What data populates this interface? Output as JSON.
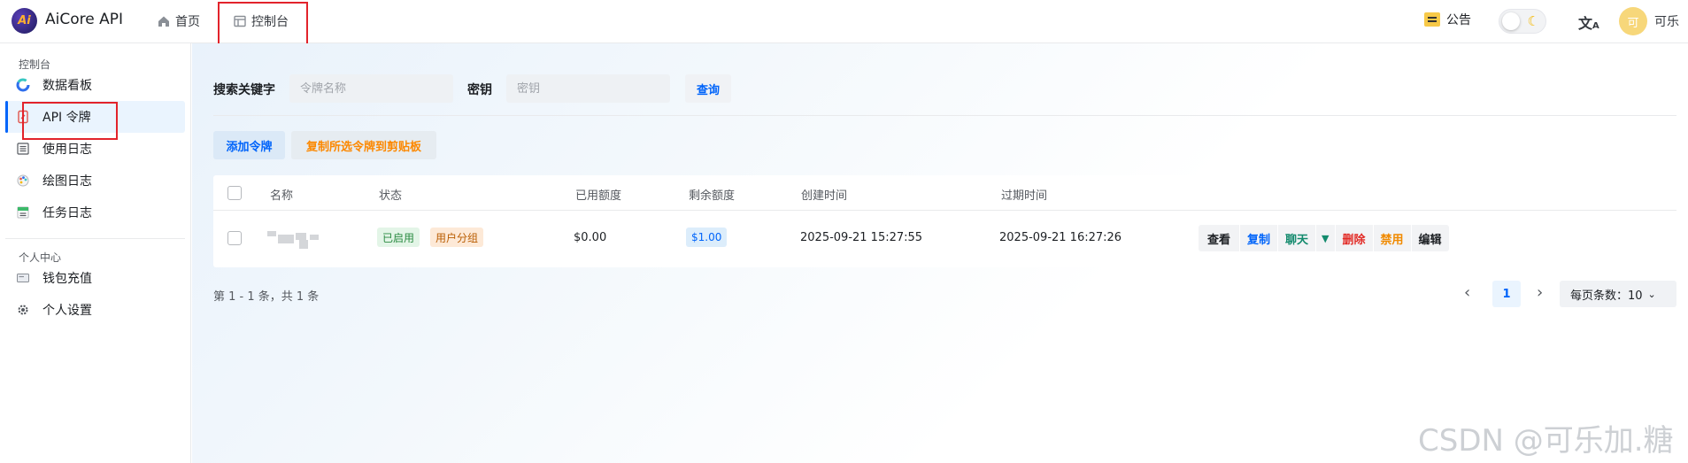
{
  "app": {
    "logo_text": "Ai",
    "name": "AiCore API"
  },
  "topnav": {
    "home_label": "首页",
    "console_label": "控制台",
    "notice_label": "公告",
    "theme_icon": "moon-icon",
    "translate_glyph": "文",
    "avatar_text": "可",
    "username": "可乐"
  },
  "sidebar": {
    "group1_label": "控制台",
    "group1_items": [
      {
        "label": "数据看板",
        "icon": "dashboard-icon"
      },
      {
        "label": "API 令牌",
        "icon": "key-icon",
        "active": true
      },
      {
        "label": "使用日志",
        "icon": "list-icon"
      },
      {
        "label": "绘图日志",
        "icon": "palette-icon"
      },
      {
        "label": "任务日志",
        "icon": "task-icon"
      }
    ],
    "group2_label": "个人中心",
    "group2_items": [
      {
        "label": "钱包充值",
        "icon": "wallet-icon"
      },
      {
        "label": "个人设置",
        "icon": "settings-icon"
      }
    ]
  },
  "search": {
    "keyword_label": "搜索关键字",
    "keyword_placeholder": "令牌名称",
    "key_label": "密钥",
    "key_placeholder": "密钥",
    "query_button": "查询"
  },
  "actions": {
    "add_token": "添加令牌",
    "copy_selected": "复制所选令牌到剪贴板"
  },
  "table": {
    "headers": [
      "名称",
      "状态",
      "已用额度",
      "剩余额度",
      "创建时间",
      "过期时间"
    ],
    "rows": [
      {
        "status": "已启用",
        "group": "用户分组",
        "used": "$0.00",
        "remaining": "$1.00",
        "created": "2025-09-21 15:27:55",
        "expires": "2025-09-21 16:27:26",
        "ops": [
          "查看",
          "复制",
          "聊天",
          "删除",
          "禁用",
          "编辑"
        ]
      }
    ]
  },
  "pagination": {
    "info": "第 1 - 1 条，共 1 条",
    "current_page": "1",
    "page_size_label": "每页条数：10"
  },
  "watermark": "CSDN @可乐加.糖",
  "colors": {
    "accent": "#0064fa",
    "highlight_box": "#e2232b",
    "success": "#2a8a41",
    "danger": "#e22b26",
    "warning": "#f08a00"
  }
}
